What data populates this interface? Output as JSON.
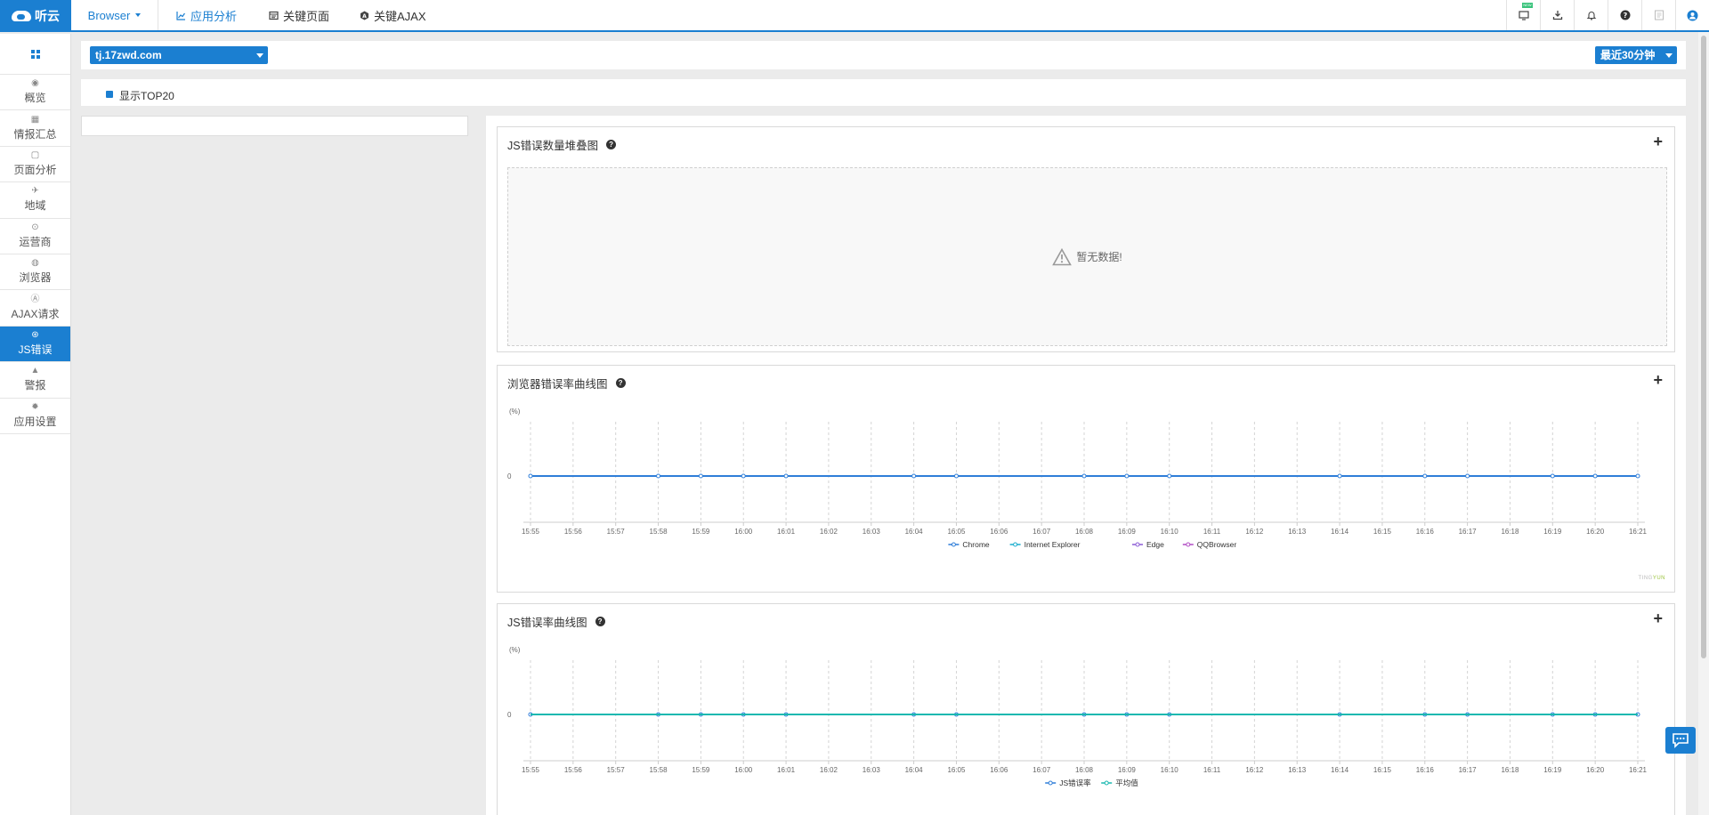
{
  "header": {
    "logo_text": "听云",
    "product_menu": "Browser",
    "nav": [
      {
        "label": "应用分析",
        "icon": "line-chart-icon",
        "active": true
      },
      {
        "label": "关键页面",
        "icon": "page-icon",
        "active": false
      },
      {
        "label": "关键AJAX",
        "icon": "ajax-icon",
        "active": false
      }
    ],
    "tools": [
      "screen-new-icon",
      "download-icon",
      "bell-icon",
      "help-icon",
      "report-icon",
      "user-icon"
    ],
    "new_badge": "NEW"
  },
  "sidebar": {
    "items": [
      {
        "label": "概览",
        "icon": "eye-icon",
        "glyph": "◉",
        "active": false
      },
      {
        "label": "情报汇总",
        "icon": "grid-icon",
        "glyph": "▦",
        "active": false
      },
      {
        "label": "页面分析",
        "icon": "page-analysis-icon",
        "glyph": "▢",
        "active": false
      },
      {
        "label": "地域",
        "icon": "map-icon",
        "glyph": "✈",
        "active": false
      },
      {
        "label": "运营商",
        "icon": "signal-icon",
        "glyph": "⊙",
        "active": false
      },
      {
        "label": "浏览器",
        "icon": "browser-icon",
        "glyph": "◍",
        "active": false
      },
      {
        "label": "AJAX请求",
        "icon": "ajax-icon",
        "glyph": "Ⓐ",
        "active": false
      },
      {
        "label": "JS错误",
        "icon": "js-error-icon",
        "glyph": "⊛",
        "active": true
      },
      {
        "label": "警报",
        "icon": "alarm-bell-icon",
        "glyph": "▲",
        "active": false
      },
      {
        "label": "应用设置",
        "icon": "settings-gear-icon",
        "glyph": "✹",
        "active": false
      }
    ]
  },
  "filter": {
    "app": "tj.17zwd.com",
    "time_range": "最近30分钟"
  },
  "options": {
    "show_top20_label": "显示TOP20",
    "show_top20_checked": true
  },
  "cards": {
    "stack": {
      "title": "JS错误数量堆叠图",
      "nodata": "暂无数据!"
    },
    "browser_rate": {
      "title": "浏览器错误率曲线图"
    },
    "js_rate": {
      "title": "JS错误率曲线图"
    }
  },
  "watermark": {
    "prefix": "TING",
    "suffix": "YUN"
  },
  "chart_data": [
    {
      "type": "line",
      "title": "浏览器错误率曲线图",
      "ylabel": "(%)",
      "x": [
        "15:55",
        "15:56",
        "15:57",
        "15:58",
        "15:59",
        "16:00",
        "16:01",
        "16:02",
        "16:03",
        "16:04",
        "16:05",
        "16:06",
        "16:07",
        "16:08",
        "16:09",
        "16:10",
        "16:11",
        "16:12",
        "16:13",
        "16:14",
        "16:15",
        "16:16",
        "16:17",
        "16:18",
        "16:19",
        "16:20",
        "16:21"
      ],
      "yticks": [
        0
      ],
      "series": [
        {
          "name": "Chrome",
          "color": "#2f7ed8",
          "values": [
            0,
            null,
            null,
            0,
            0,
            0,
            0,
            null,
            null,
            0,
            0,
            null,
            null,
            0,
            0,
            0,
            null,
            null,
            null,
            0,
            null,
            0,
            0,
            null,
            0,
            0,
            0
          ]
        },
        {
          "name": "Internet Explorer",
          "color": "#1aadce",
          "values": []
        },
        {
          "name": "Edge",
          "color": "#8c5cd6",
          "values": []
        },
        {
          "name": "QQBrowser",
          "color": "#b14cc4",
          "values": []
        }
      ],
      "grid": true,
      "legend": "bottom-center"
    },
    {
      "type": "line",
      "title": "JS错误率曲线图",
      "ylabel": "(%)",
      "x": [
        "15:55",
        "15:56",
        "15:57",
        "15:58",
        "15:59",
        "16:00",
        "16:01",
        "16:02",
        "16:03",
        "16:04",
        "16:05",
        "16:06",
        "16:07",
        "16:08",
        "16:09",
        "16:10",
        "16:11",
        "16:12",
        "16:13",
        "16:14",
        "16:15",
        "16:16",
        "16:17",
        "16:18",
        "16:19",
        "16:20",
        "16:21"
      ],
      "yticks": [
        0
      ],
      "series": [
        {
          "name": "JS错误率",
          "color": "#2f7ed8",
          "values": [
            0,
            null,
            null,
            0,
            0,
            0,
            0,
            null,
            null,
            0,
            0,
            null,
            null,
            0,
            0,
            0,
            null,
            null,
            null,
            0,
            null,
            0,
            0,
            null,
            0,
            0,
            0
          ]
        },
        {
          "name": "平均值",
          "color": "#1ab8b0",
          "values": [
            0,
            0,
            0,
            0,
            0,
            0,
            0,
            0,
            0,
            0,
            0,
            0,
            0,
            0,
            0,
            0,
            0,
            0,
            0,
            0,
            0,
            0,
            0,
            0,
            0,
            0,
            0
          ]
        }
      ],
      "grid": true,
      "legend": "bottom-center"
    }
  ]
}
